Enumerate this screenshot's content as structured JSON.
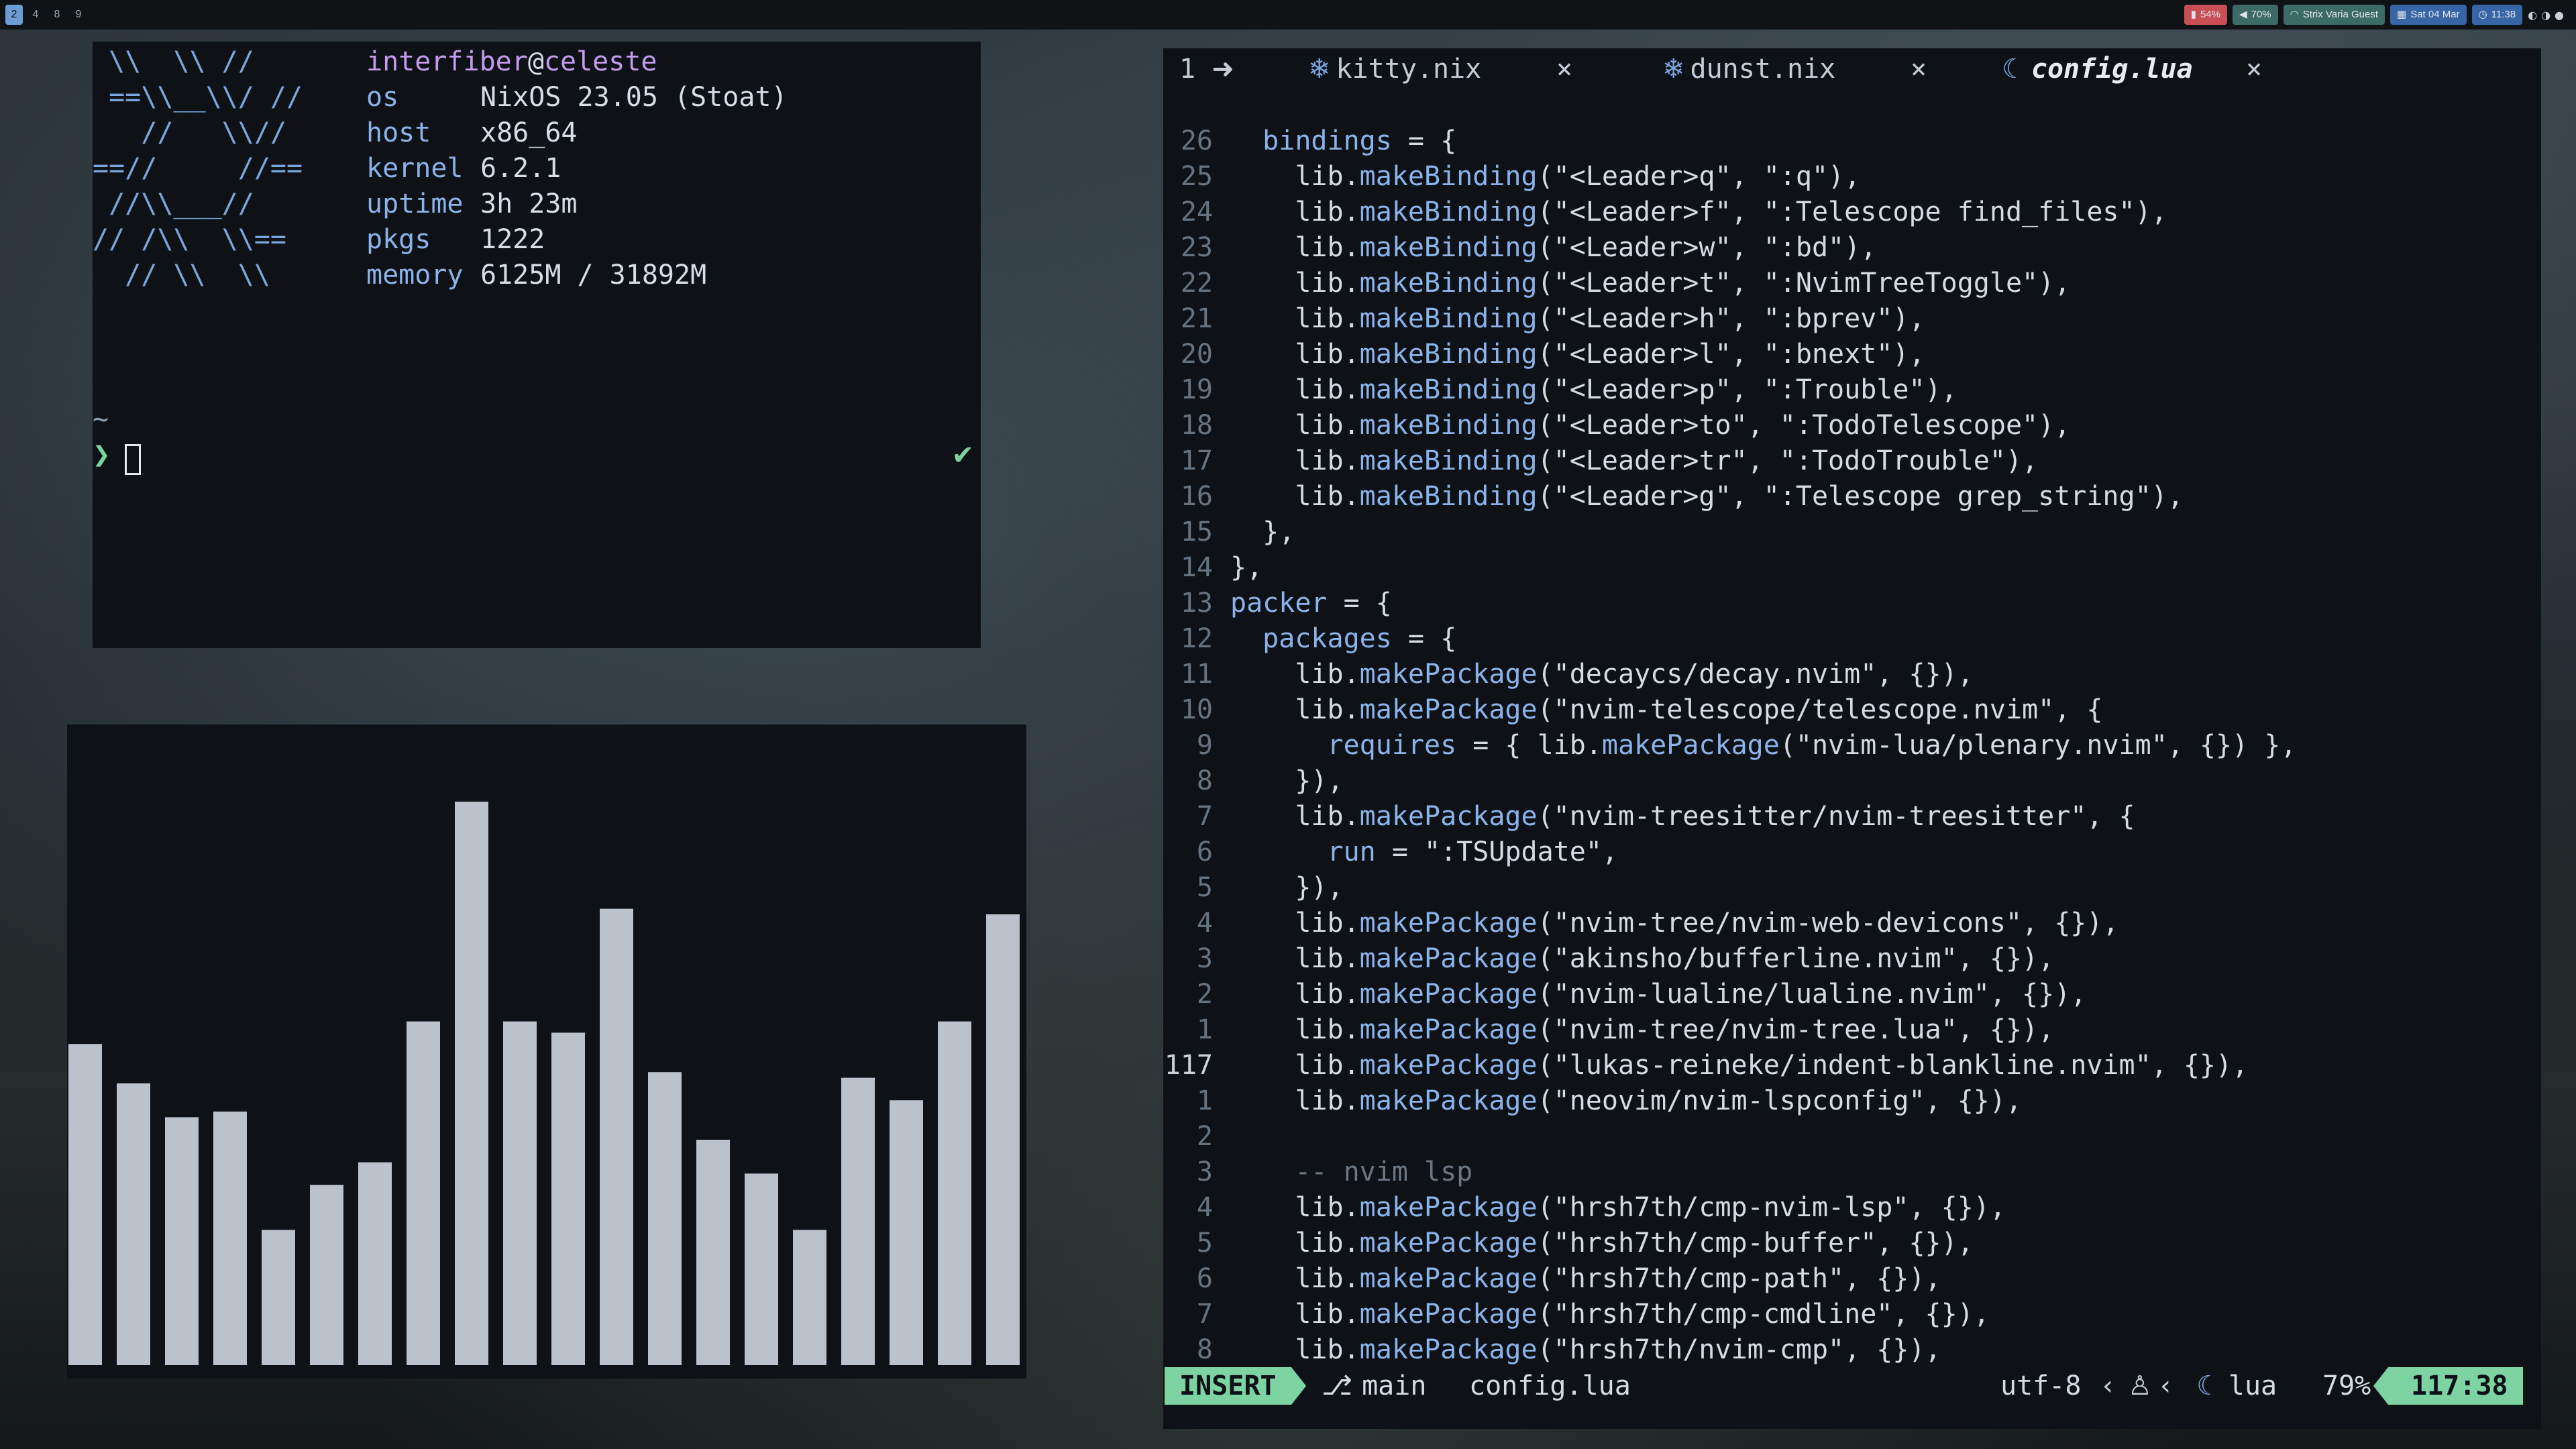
{
  "topbar": {
    "workspaces": [
      "2",
      "4",
      "8",
      "9"
    ],
    "battery": "54%",
    "volume": "70%",
    "wifi": "Strix Varia Guest",
    "date": "Sat 04 Mar",
    "time": "11:38",
    "colors": {
      "battery": "#c94f57",
      "volume": "#3c6a67",
      "wifi": "#3c6a67",
      "date": "#3765a6",
      "time": "#3765a6"
    }
  },
  "fetch": {
    "logo": " \\\\  \\\\ //\n ==\\\\__\\\\/ //\n   //   \\\\//\n==//     //==\n //\\\\___//\n// /\\\\  \\\\==\n  // \\\\  \\\\",
    "user": "interfiber",
    "host_name": "celeste",
    "at": "@",
    "rows": [
      {
        "key": "os",
        "value": "NixOS 23.05 (Stoat)"
      },
      {
        "key": "host",
        "value": "x86_64"
      },
      {
        "key": "kernel",
        "value": "6.2.1"
      },
      {
        "key": "uptime",
        "value": "3h 23m"
      },
      {
        "key": "pkgs",
        "value": "1222"
      },
      {
        "key": "memory",
        "value": "6125M / 31892M"
      }
    ],
    "cwd": "~",
    "prompt": "❯",
    "check": "✔"
  },
  "visualizer": {
    "bars": [
      0.57,
      0.5,
      0.44,
      0.45,
      0.24,
      0.32,
      0.36,
      0.61,
      1.0,
      0.61,
      0.59,
      0.81,
      0.52,
      0.4,
      0.34,
      0.24,
      0.51,
      0.47,
      0.61,
      0.8
    ],
    "bar_color": "#bcc2cc"
  },
  "editor": {
    "bufnum": "1",
    "tabs": [
      {
        "name": "kitty.nix",
        "active": false
      },
      {
        "name": "dunst.nix",
        "active": false
      },
      {
        "name": "config.lua",
        "active": true
      }
    ],
    "tab_close": "×",
    "lines": [
      {
        "n": "26",
        "t": "  bindings = {"
      },
      {
        "n": "25",
        "t": "    lib.makeBinding(\"<Leader>q\", \":q\"),"
      },
      {
        "n": "24",
        "t": "    lib.makeBinding(\"<Leader>f\", \":Telescope find_files\"),"
      },
      {
        "n": "23",
        "t": "    lib.makeBinding(\"<Leader>w\", \":bd\"),"
      },
      {
        "n": "22",
        "t": "    lib.makeBinding(\"<Leader>t\", \":NvimTreeToggle\"),"
      },
      {
        "n": "21",
        "t": "    lib.makeBinding(\"<Leader>h\", \":bprev\"),"
      },
      {
        "n": "20",
        "t": "    lib.makeBinding(\"<Leader>l\", \":bnext\"),"
      },
      {
        "n": "19",
        "t": "    lib.makeBinding(\"<Leader>p\", \":Trouble\"),"
      },
      {
        "n": "18",
        "t": "    lib.makeBinding(\"<Leader>to\", \":TodoTelescope\"),"
      },
      {
        "n": "17",
        "t": "    lib.makeBinding(\"<Leader>tr\", \":TodoTrouble\"),"
      },
      {
        "n": "16",
        "t": "    lib.makeBinding(\"<Leader>g\", \":Telescope grep_string\"),"
      },
      {
        "n": "15",
        "t": "  },"
      },
      {
        "n": "14",
        "t": "},"
      },
      {
        "n": "13",
        "t": "packer = {"
      },
      {
        "n": "12",
        "t": "  packages = {"
      },
      {
        "n": "11",
        "t": "    lib.makePackage(\"decaycs/decay.nvim\", {}),"
      },
      {
        "n": "10",
        "t": "    lib.makePackage(\"nvim-telescope/telescope.nvim\", {"
      },
      {
        "n": "9",
        "t": "      requires = { lib.makePackage(\"nvim-lua/plenary.nvim\", {}) },"
      },
      {
        "n": "8",
        "t": "    }),"
      },
      {
        "n": "7",
        "t": "    lib.makePackage(\"nvim-treesitter/nvim-treesitter\", {"
      },
      {
        "n": "6",
        "t": "      run = \":TSUpdate\","
      },
      {
        "n": "5",
        "t": "    }),"
      },
      {
        "n": "4",
        "t": "    lib.makePackage(\"nvim-tree/nvim-web-devicons\", {}),"
      },
      {
        "n": "3",
        "t": "    lib.makePackage(\"akinsho/bufferline.nvim\", {}),"
      },
      {
        "n": "2",
        "t": "    lib.makePackage(\"nvim-lualine/lualine.nvim\", {}),"
      },
      {
        "n": "1",
        "t": "    lib.makePackage(\"nvim-tree/nvim-tree.lua\", {}),"
      },
      {
        "n": "117",
        "t": "    lib.makePackage(\"lukas-reineke/indent-blankline.nvim\", {}),",
        "current": true
      },
      {
        "n": "1",
        "t": "    lib.makePackage(\"neovim/nvim-lspconfig\", {}),"
      },
      {
        "n": "2",
        "t": ""
      },
      {
        "n": "3",
        "t": "    -- nvim lsp"
      },
      {
        "n": "4",
        "t": "    lib.makePackage(\"hrsh7th/cmp-nvim-lsp\", {}),"
      },
      {
        "n": "5",
        "t": "    lib.makePackage(\"hrsh7th/cmp-buffer\", {}),"
      },
      {
        "n": "6",
        "t": "    lib.makePackage(\"hrsh7th/cmp-path\", {}),"
      },
      {
        "n": "7",
        "t": "    lib.makePackage(\"hrsh7th/cmp-cmdline\", {}),"
      },
      {
        "n": "8",
        "t": "    lib.makePackage(\"hrsh7th/nvim-cmp\", {}),"
      }
    ],
    "statusline": {
      "mode": "INSERT",
      "branch": "main",
      "file": "config.lua",
      "encoding": "utf-8",
      "filetype": "lua",
      "percent": "79%",
      "position": "117:38"
    },
    "syntax_colors": {
      "default": "#d5dbe3",
      "key": "#8bb3ea",
      "func": "#8bb3ea",
      "string": "#d5dbe3",
      "comment": "#6b7682",
      "punct": "#d5dbe3"
    }
  }
}
